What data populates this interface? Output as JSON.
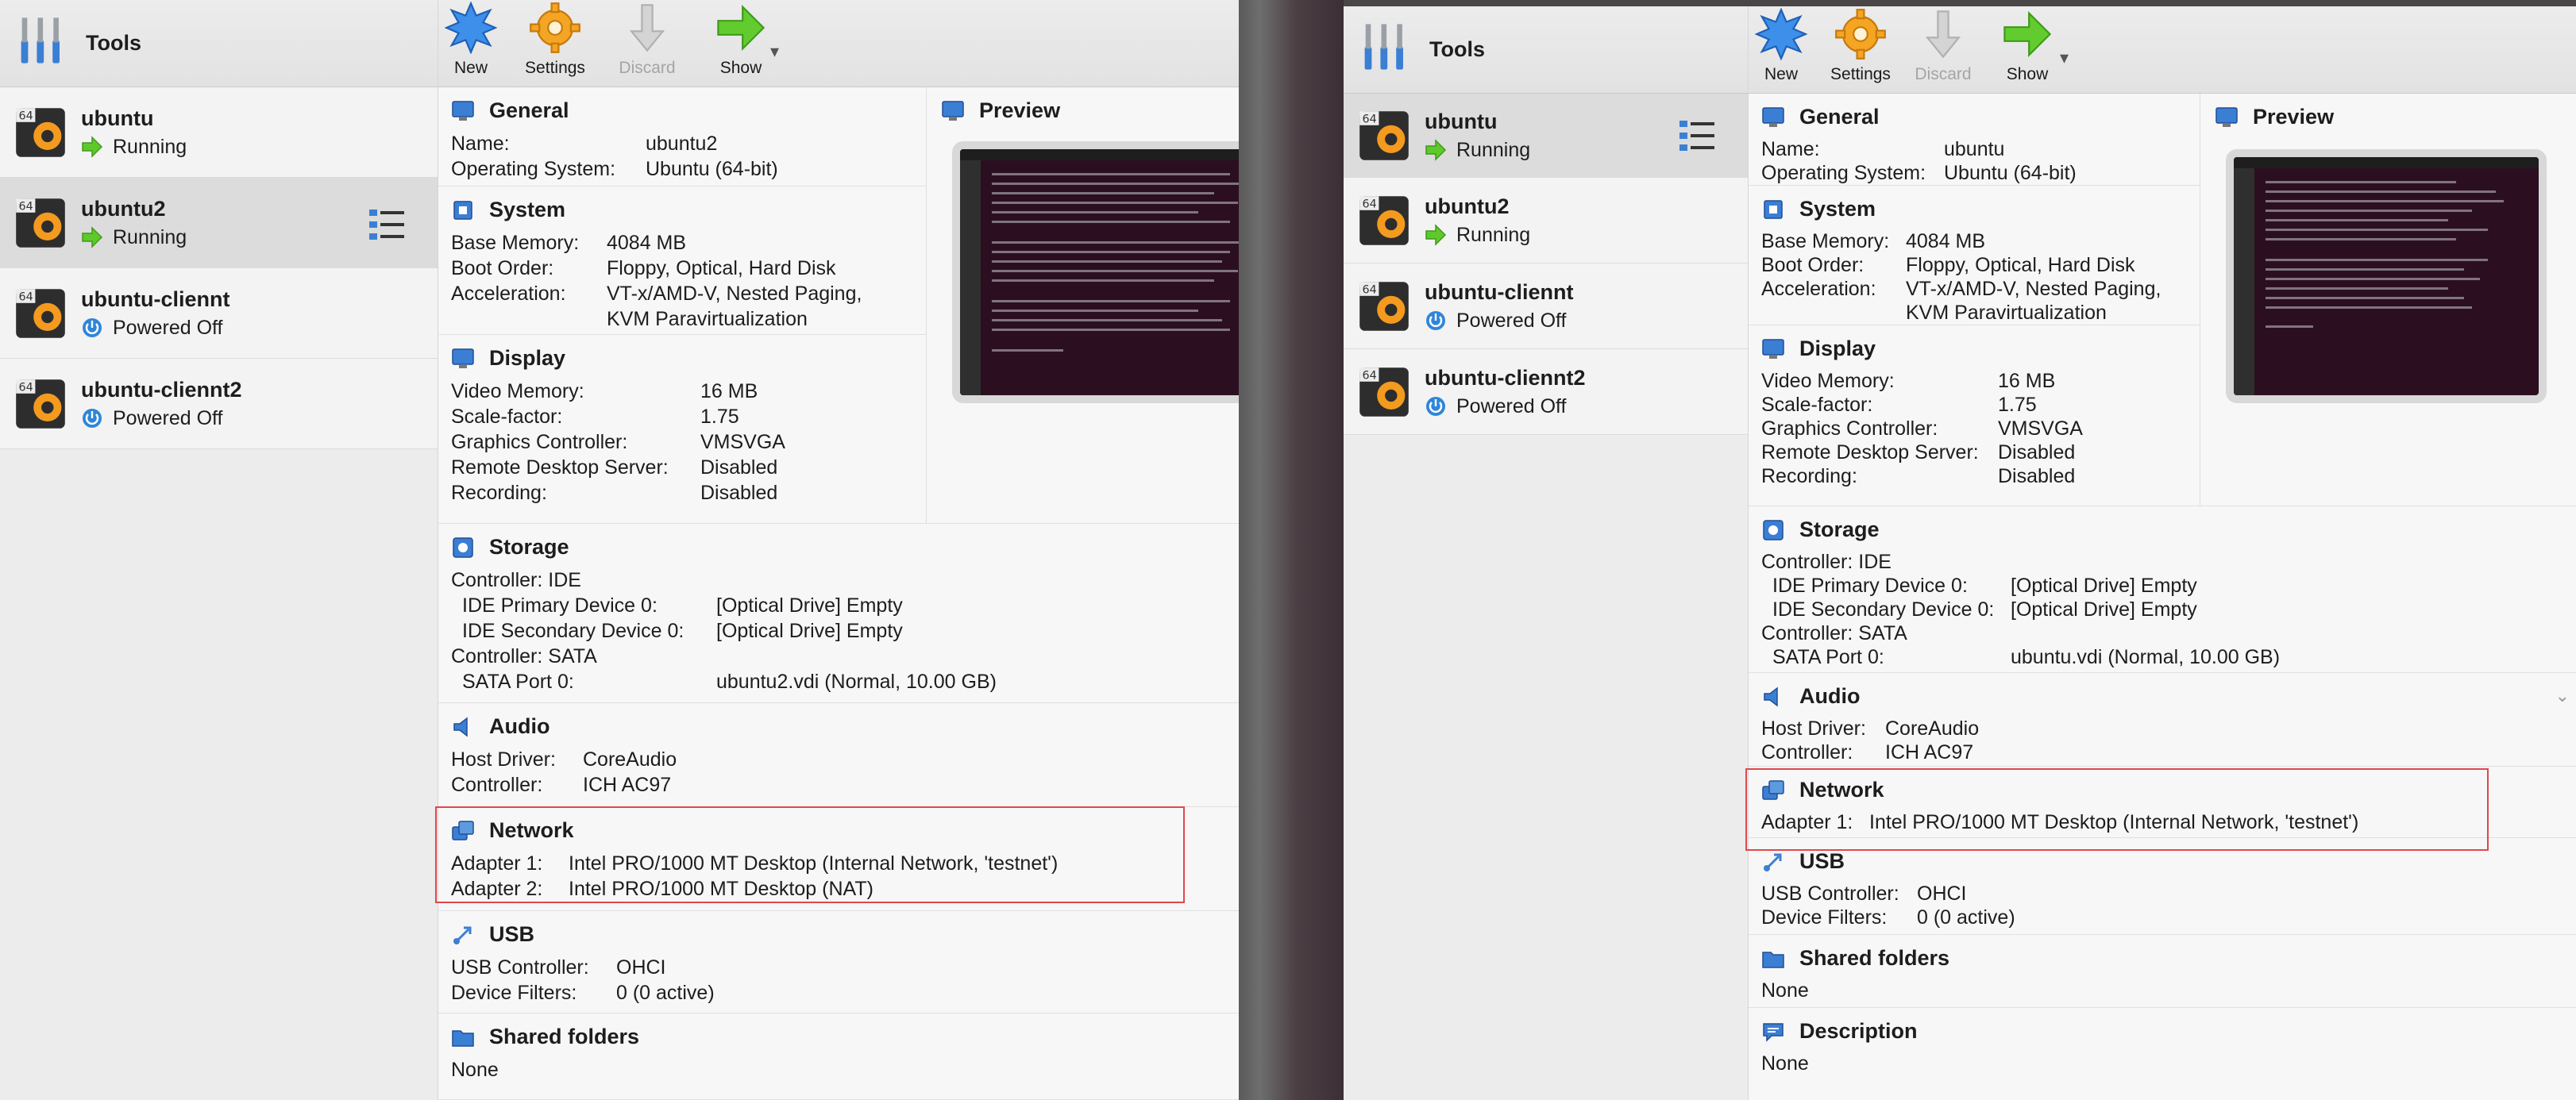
{
  "colors": {
    "window_bg": "#ececec",
    "detail_bg": "#f7f7f7",
    "highlight": "#e0474c",
    "running_arrow": "#5fc92c",
    "poweroff_icon": "#2f86d8",
    "new_icon": "#2f7fe0",
    "settings_icon": "#f2a21c",
    "show_icon": "#5fc92c"
  },
  "left": {
    "toolbar": {
      "tools_label": "Tools",
      "new_label": "New",
      "settings_label": "Settings",
      "discard_label": "Discard",
      "show_label": "Show"
    },
    "vms": [
      {
        "name": "ubuntu",
        "state": "Running",
        "badge": "64"
      },
      {
        "name": "ubuntu2",
        "state": "Running",
        "badge": "64"
      },
      {
        "name": "ubuntu-clie​nnt",
        "state": "Powered Off",
        "badge": "64"
      },
      {
        "name": "ubuntu-clie​nnt2",
        "state": "Powered Off",
        "badge": "64"
      }
    ],
    "general": {
      "title": "General",
      "name_k": "Name:",
      "name_v": "ubuntu2",
      "os_k": "Operating System:",
      "os_v": "Ubuntu (64-bit)"
    },
    "preview": {
      "title": "Preview"
    },
    "system": {
      "title": "System",
      "mem_k": "Base Memory:",
      "mem_v": "4084 MB",
      "boot_k": "Boot Order:",
      "boot_v": "Floppy, Optical, Hard Disk",
      "acc_k": "Acceleration:",
      "acc_v1": "VT-x/AMD-V, Nested Paging,",
      "acc_v2": "KVM Paravirtualization"
    },
    "display": {
      "title": "Display",
      "vmem_k": "Video Memory:",
      "vmem_v": "16 MB",
      "scale_k": "Scale-factor:",
      "scale_v": "1.75",
      "gc_k": "Graphics Controller:",
      "gc_v": "VMSVGA",
      "rds_k": "Remote Desktop Server:",
      "rds_v": "Disabled",
      "rec_k": "Recording:",
      "rec_v": "Disabled"
    },
    "storage": {
      "title": "Storage",
      "ctl_ide": "Controller: IDE",
      "ide0_k": "IDE Primary Device 0:",
      "ide0_v": "[Optical Drive] Empty",
      "ide1_k": "IDE Secondary Device 0:",
      "ide1_v": "[Optical Drive] Empty",
      "ctl_sata": "Controller: SATA",
      "sata0_k": "SATA Port 0:",
      "sata0_v": "ubuntu2.vdi (Normal, 10.00 GB)"
    },
    "audio": {
      "title": "Audio",
      "host_k": "Host Driver:",
      "host_v": "CoreAudio",
      "ctl_k": "Controller:",
      "ctl_v": "ICH AC97"
    },
    "network": {
      "title": "Network",
      "a1_k": "Adapter 1:",
      "a1_v": "Intel PRO/1000 MT Desktop (Internal Network, 'testnet')",
      "a2_k": "Adapter 2:",
      "a2_v": "Intel PRO/1000 MT Desktop (NAT)"
    },
    "usb": {
      "title": "USB",
      "ctl_k": "USB Controller:",
      "ctl_v": "OHCI",
      "filt_k": "Device Filters:",
      "filt_v": "0 (0 active)"
    },
    "shared": {
      "title": "Shared folders",
      "value": "None"
    }
  },
  "right": {
    "toolbar": {
      "tools_label": "Tools",
      "new_label": "New",
      "settings_label": "Settings",
      "discard_label": "Discard",
      "show_label": "Show"
    },
    "vms": [
      {
        "name": "ubuntu",
        "state": "Running",
        "badge": "64"
      },
      {
        "name": "ubuntu2",
        "state": "Running",
        "badge": "64"
      },
      {
        "name": "ubuntu-clie​nnt",
        "state": "Powered Off",
        "badge": "64"
      },
      {
        "name": "ubuntu-clie​nnt2",
        "state": "Powered Off",
        "badge": "64"
      }
    ],
    "general": {
      "title": "General",
      "name_k": "Name:",
      "name_v": "ubuntu",
      "os_k": "Operating System:",
      "os_v": "Ubuntu (64-bit)"
    },
    "preview": {
      "title": "Preview"
    },
    "system": {
      "title": "System",
      "mem_k": "Base Memory:",
      "mem_v": "4084 MB",
      "boot_k": "Boot Order:",
      "boot_v": "Floppy, Optical, Hard Disk",
      "acc_k": "Acceleration:",
      "acc_v1": "VT-x/AMD-V, Nested Paging,",
      "acc_v2": "KVM Paravirtualization"
    },
    "display": {
      "title": "Display",
      "vmem_k": "Video Memory:",
      "vmem_v": "16 MB",
      "scale_k": "Scale-factor:",
      "scale_v": "1.75",
      "gc_k": "Graphics Controller:",
      "gc_v": "VMSVGA",
      "rds_k": "Remote Desktop Server:",
      "rds_v": "Disabled",
      "rec_k": "Recording:",
      "rec_v": "Disabled"
    },
    "storage": {
      "title": "Storage",
      "ctl_ide": "Controller: IDE",
      "ide0_k": "IDE Primary Device 0:",
      "ide0_v": "[Optical Drive] Empty",
      "ide1_k": "IDE Secondary Device 0:",
      "ide1_v": "[Optical Drive] Empty",
      "ctl_sata": "Controller: SATA",
      "sata0_k": "SATA Port 0:",
      "sata0_v": "ubuntu.vdi (Normal, 10.00 GB)"
    },
    "audio": {
      "title": "Audio",
      "host_k": "Host Driver:",
      "host_v": "CoreAudio",
      "ctl_k": "Controller:",
      "ctl_v": "ICH AC97"
    },
    "network": {
      "title": "Network",
      "a1_k": "Adapter 1:",
      "a1_v": "Intel PRO/1000 MT Desktop (Internal Network, 'testnet')"
    },
    "usb": {
      "title": "USB",
      "ctl_k": "USB Controller:",
      "ctl_v": "OHCI",
      "filt_k": "Device Filters:",
      "filt_v": "0 (0 active)"
    },
    "shared": {
      "title": "Shared folders",
      "value": "None"
    },
    "description": {
      "title": "Description",
      "value": "None"
    }
  }
}
